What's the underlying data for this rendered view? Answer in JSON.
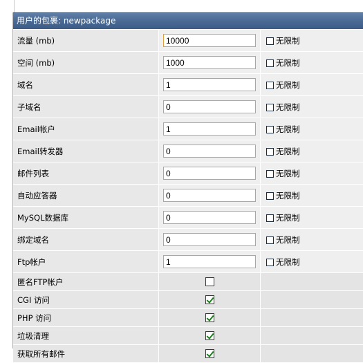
{
  "header": {
    "title": "用户的包裹: newpackage"
  },
  "unlimited_label": "无限制",
  "numeric_rows": [
    {
      "label": "流量 (mb)",
      "value": "10000",
      "focused": true
    },
    {
      "label": "空间 (mb)",
      "value": "1000"
    },
    {
      "label": "域名",
      "value": "1"
    },
    {
      "label": "子域名",
      "value": "0"
    },
    {
      "label": "Email帐户",
      "value": "1"
    },
    {
      "label": "Email转发器",
      "value": "0"
    },
    {
      "label": "邮件列表",
      "value": "0"
    },
    {
      "label": "自动应答器",
      "value": "0"
    },
    {
      "label": "MySQL数据库",
      "value": "0"
    },
    {
      "label": "绑定域名",
      "value": "0"
    },
    {
      "label": "Ftp帐户",
      "value": "1"
    }
  ],
  "check_rows": [
    {
      "label": "匿名FTP帐户",
      "checked": false
    },
    {
      "label": "CGI 访问",
      "checked": true
    },
    {
      "label": "PHP 访问",
      "checked": true
    },
    {
      "label": "垃圾清理",
      "checked": true
    },
    {
      "label": "获取所有邮件",
      "checked": true
    }
  ]
}
